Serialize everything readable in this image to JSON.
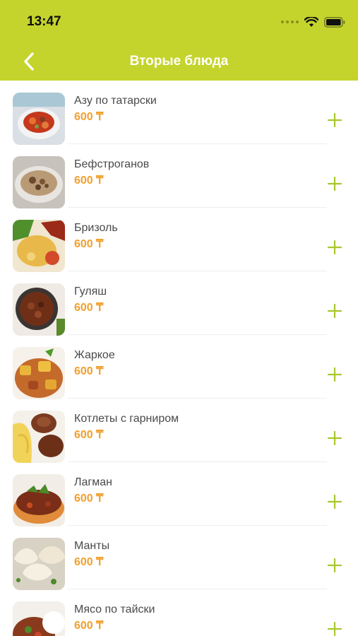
{
  "status_bar": {
    "time": "13:47"
  },
  "nav": {
    "title": "Вторые блюда"
  },
  "colors": {
    "header": "#c4d42c",
    "price": "#f0a030",
    "accent": "#a8c82a"
  },
  "items": [
    {
      "name": "Азу по татарски",
      "price": "600 ₸",
      "image": "stew-dish-image"
    },
    {
      "name": "Бефстроганов",
      "price": "600 ₸",
      "image": "stroganoff-image"
    },
    {
      "name": "Бризоль",
      "price": "600 ₸",
      "image": "brizol-image"
    },
    {
      "name": "Гуляш",
      "price": "600 ₸",
      "image": "goulash-image"
    },
    {
      "name": "Жаркое",
      "price": "600 ₸",
      "image": "roast-image"
    },
    {
      "name": "Котлеты с гарниром",
      "price": "600 ₸",
      "image": "cutlets-image"
    },
    {
      "name": "Лагман",
      "price": "600 ₸",
      "image": "lagman-image"
    },
    {
      "name": "Манты",
      "price": "600 ₸",
      "image": "manty-image"
    },
    {
      "name": "Мясо по тайски",
      "price": "600 ₸",
      "image": "thai-meat-image"
    }
  ]
}
